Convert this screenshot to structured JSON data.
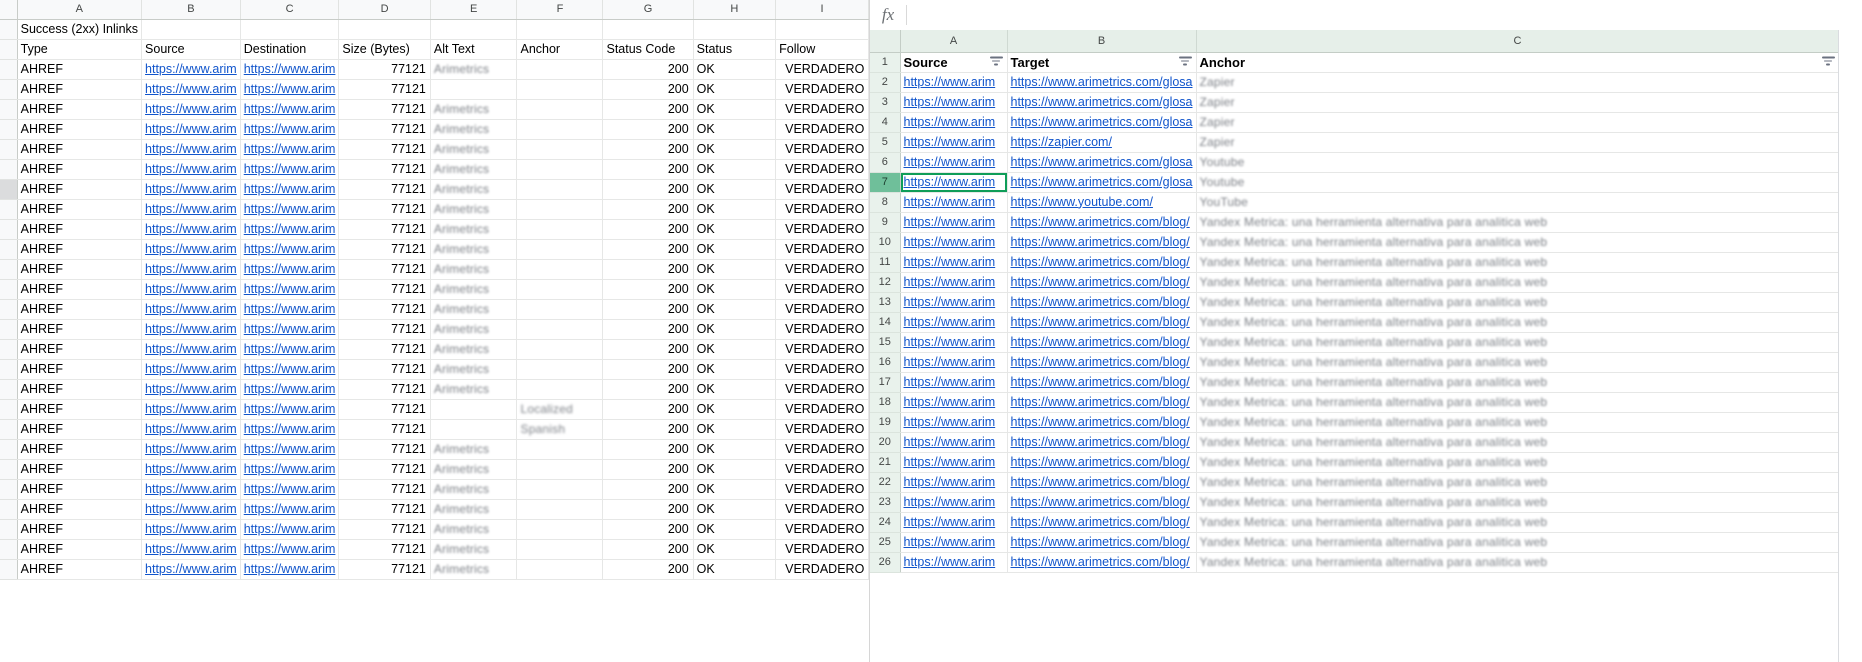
{
  "left_sheet": {
    "title_cell": "Success (2xx) Inlinks",
    "column_letters": [
      "A",
      "B",
      "C",
      "D",
      "E",
      "F",
      "G",
      "H",
      "I"
    ],
    "headers": [
      "Type",
      "Source",
      "Destination",
      "Size (Bytes)",
      "Alt Text",
      "Anchor",
      "Status Code",
      "Status",
      "Follow"
    ],
    "selected_row_index": 6,
    "rows": [
      {
        "type": "AHREF",
        "source": "https://www.arim",
        "destination": "https://www.arim",
        "size": "77121",
        "alt": "Arimetrics",
        "anchor": "",
        "status_code": "200",
        "status": "OK",
        "follow": "VERDADERO"
      },
      {
        "type": "AHREF",
        "source": "https://www.arim",
        "destination": "https://www.arim",
        "size": "77121",
        "alt": "",
        "anchor": "",
        "status_code": "200",
        "status": "OK",
        "follow": "VERDADERO"
      },
      {
        "type": "AHREF",
        "source": "https://www.arim",
        "destination": "https://www.arim",
        "size": "77121",
        "alt": "Arimetrics",
        "anchor": "",
        "status_code": "200",
        "status": "OK",
        "follow": "VERDADERO"
      },
      {
        "type": "AHREF",
        "source": "https://www.arim",
        "destination": "https://www.arim",
        "size": "77121",
        "alt": "Arimetrics",
        "anchor": "",
        "status_code": "200",
        "status": "OK",
        "follow": "VERDADERO"
      },
      {
        "type": "AHREF",
        "source": "https://www.arim",
        "destination": "https://www.arim",
        "size": "77121",
        "alt": "Arimetrics",
        "anchor": "",
        "status_code": "200",
        "status": "OK",
        "follow": "VERDADERO"
      },
      {
        "type": "AHREF",
        "source": "https://www.arim",
        "destination": "https://www.arim",
        "size": "77121",
        "alt": "Arimetrics",
        "anchor": "",
        "status_code": "200",
        "status": "OK",
        "follow": "VERDADERO"
      },
      {
        "type": "AHREF",
        "source": "https://www.arim",
        "destination": "https://www.arim",
        "size": "77121",
        "alt": "Arimetrics",
        "anchor": "",
        "status_code": "200",
        "status": "OK",
        "follow": "VERDADERO"
      },
      {
        "type": "AHREF",
        "source": "https://www.arim",
        "destination": "https://www.arim",
        "size": "77121",
        "alt": "Arimetrics",
        "anchor": "",
        "status_code": "200",
        "status": "OK",
        "follow": "VERDADERO"
      },
      {
        "type": "AHREF",
        "source": "https://www.arim",
        "destination": "https://www.arim",
        "size": "77121",
        "alt": "Arimetrics",
        "anchor": "",
        "status_code": "200",
        "status": "OK",
        "follow": "VERDADERO"
      },
      {
        "type": "AHREF",
        "source": "https://www.arim",
        "destination": "https://www.arim",
        "size": "77121",
        "alt": "Arimetrics",
        "anchor": "",
        "status_code": "200",
        "status": "OK",
        "follow": "VERDADERO"
      },
      {
        "type": "AHREF",
        "source": "https://www.arim",
        "destination": "https://www.arim",
        "size": "77121",
        "alt": "Arimetrics",
        "anchor": "",
        "status_code": "200",
        "status": "OK",
        "follow": "VERDADERO"
      },
      {
        "type": "AHREF",
        "source": "https://www.arim",
        "destination": "https://www.arim",
        "size": "77121",
        "alt": "Arimetrics",
        "anchor": "",
        "status_code": "200",
        "status": "OK",
        "follow": "VERDADERO"
      },
      {
        "type": "AHREF",
        "source": "https://www.arim",
        "destination": "https://www.arim",
        "size": "77121",
        "alt": "Arimetrics",
        "anchor": "",
        "status_code": "200",
        "status": "OK",
        "follow": "VERDADERO"
      },
      {
        "type": "AHREF",
        "source": "https://www.arim",
        "destination": "https://www.arim",
        "size": "77121",
        "alt": "Arimetrics",
        "anchor": "",
        "status_code": "200",
        "status": "OK",
        "follow": "VERDADERO"
      },
      {
        "type": "AHREF",
        "source": "https://www.arim",
        "destination": "https://www.arim",
        "size": "77121",
        "alt": "Arimetrics",
        "anchor": "",
        "status_code": "200",
        "status": "OK",
        "follow": "VERDADERO"
      },
      {
        "type": "AHREF",
        "source": "https://www.arim",
        "destination": "https://www.arim",
        "size": "77121",
        "alt": "Arimetrics",
        "anchor": "",
        "status_code": "200",
        "status": "OK",
        "follow": "VERDADERO"
      },
      {
        "type": "AHREF",
        "source": "https://www.arim",
        "destination": "https://www.arim",
        "size": "77121",
        "alt": "Arimetrics",
        "anchor": "",
        "status_code": "200",
        "status": "OK",
        "follow": "VERDADERO"
      },
      {
        "type": "AHREF",
        "source": "https://www.arim",
        "destination": "https://www.arim",
        "size": "77121",
        "alt": "",
        "anchor": "Localized",
        "status_code": "200",
        "status": "OK",
        "follow": "VERDADERO"
      },
      {
        "type": "AHREF",
        "source": "https://www.arim",
        "destination": "https://www.arim",
        "size": "77121",
        "alt": "",
        "anchor": "Spanish",
        "status_code": "200",
        "status": "OK",
        "follow": "VERDADERO"
      },
      {
        "type": "AHREF",
        "source": "https://www.arim",
        "destination": "https://www.arim",
        "size": "77121",
        "alt": "Arimetrics",
        "anchor": "",
        "status_code": "200",
        "status": "OK",
        "follow": "VERDADERO"
      },
      {
        "type": "AHREF",
        "source": "https://www.arim",
        "destination": "https://www.arim",
        "size": "77121",
        "alt": "Arimetrics",
        "anchor": "",
        "status_code": "200",
        "status": "OK",
        "follow": "VERDADERO"
      },
      {
        "type": "AHREF",
        "source": "https://www.arim",
        "destination": "https://www.arim",
        "size": "77121",
        "alt": "Arimetrics",
        "anchor": "",
        "status_code": "200",
        "status": "OK",
        "follow": "VERDADERO"
      },
      {
        "type": "AHREF",
        "source": "https://www.arim",
        "destination": "https://www.arim",
        "size": "77121",
        "alt": "Arimetrics",
        "anchor": "",
        "status_code": "200",
        "status": "OK",
        "follow": "VERDADERO"
      },
      {
        "type": "AHREF",
        "source": "https://www.arim",
        "destination": "https://www.arim",
        "size": "77121",
        "alt": "Arimetrics",
        "anchor": "",
        "status_code": "200",
        "status": "OK",
        "follow": "VERDADERO"
      },
      {
        "type": "AHREF",
        "source": "https://www.arim",
        "destination": "https://www.arim",
        "size": "77121",
        "alt": "Arimetrics",
        "anchor": "",
        "status_code": "200",
        "status": "OK",
        "follow": "VERDADERO"
      },
      {
        "type": "AHREF",
        "source": "https://www.arim",
        "destination": "https://www.arim",
        "size": "77121",
        "alt": "Arimetrics",
        "anchor": "",
        "status_code": "200",
        "status": "OK",
        "follow": "VERDADERO"
      }
    ]
  },
  "right_sheet": {
    "formula_bar": {
      "glyph": "fx",
      "value": "",
      "placeholder": ""
    },
    "column_letters": [
      "A",
      "B",
      "C"
    ],
    "headers": [
      "Source",
      "Target",
      "Anchor"
    ],
    "header_row_number": "1",
    "selected_row_number": "7",
    "filter_icon": "filter-icon",
    "accent_color": "#0f9d58",
    "header_bg": "#e6efe9",
    "link_color": "#1155cc",
    "rows": [
      {
        "n": "2",
        "source": "https://www.arim",
        "target": "https://www.arimetrics.com/glosa",
        "anchor": "Zapier"
      },
      {
        "n": "3",
        "source": "https://www.arim",
        "target": "https://www.arimetrics.com/glosa",
        "anchor": "Zapier"
      },
      {
        "n": "4",
        "source": "https://www.arim",
        "target": "https://www.arimetrics.com/glosa",
        "anchor": "Zapier"
      },
      {
        "n": "5",
        "source": "https://www.arim",
        "target": "https://zapier.com/",
        "anchor": "Zapier"
      },
      {
        "n": "6",
        "source": "https://www.arim",
        "target": "https://www.arimetrics.com/glosa",
        "anchor": "Youtube"
      },
      {
        "n": "7",
        "source": "https://www.arim",
        "target": "https://www.arimetrics.com/glosa",
        "anchor": "Youtube"
      },
      {
        "n": "8",
        "source": "https://www.arim",
        "target": "https://www.youtube.com/",
        "anchor": "YouTube"
      },
      {
        "n": "9",
        "source": "https://www.arim",
        "target": "https://www.arimetrics.com/blog/",
        "anchor": "Yandex Metrica: una herramienta alternativa para analitica web"
      },
      {
        "n": "10",
        "source": "https://www.arim",
        "target": "https://www.arimetrics.com/blog/",
        "anchor": "Yandex Metrica: una herramienta alternativa para analitica web"
      },
      {
        "n": "11",
        "source": "https://www.arim",
        "target": "https://www.arimetrics.com/blog/",
        "anchor": "Yandex Metrica: una herramienta alternativa para analitica web"
      },
      {
        "n": "12",
        "source": "https://www.arim",
        "target": "https://www.arimetrics.com/blog/",
        "anchor": "Yandex Metrica: una herramienta alternativa para analitica web"
      },
      {
        "n": "13",
        "source": "https://www.arim",
        "target": "https://www.arimetrics.com/blog/",
        "anchor": "Yandex Metrica: una herramienta alternativa para analitica web"
      },
      {
        "n": "14",
        "source": "https://www.arim",
        "target": "https://www.arimetrics.com/blog/",
        "anchor": "Yandex Metrica: una herramienta alternativa para analitica web"
      },
      {
        "n": "15",
        "source": "https://www.arim",
        "target": "https://www.arimetrics.com/blog/",
        "anchor": "Yandex Metrica: una herramienta alternativa para analitica web"
      },
      {
        "n": "16",
        "source": "https://www.arim",
        "target": "https://www.arimetrics.com/blog/",
        "anchor": "Yandex Metrica: una herramienta alternativa para analitica web"
      },
      {
        "n": "17",
        "source": "https://www.arim",
        "target": "https://www.arimetrics.com/blog/",
        "anchor": "Yandex Metrica: una herramienta alternativa para analitica web"
      },
      {
        "n": "18",
        "source": "https://www.arim",
        "target": "https://www.arimetrics.com/blog/",
        "anchor": "Yandex Metrica: una herramienta alternativa para analitica web"
      },
      {
        "n": "19",
        "source": "https://www.arim",
        "target": "https://www.arimetrics.com/blog/",
        "anchor": "Yandex Metrica: una herramienta alternativa para analitica web"
      },
      {
        "n": "20",
        "source": "https://www.arim",
        "target": "https://www.arimetrics.com/blog/",
        "anchor": "Yandex Metrica: una herramienta alternativa para analitica web"
      },
      {
        "n": "21",
        "source": "https://www.arim",
        "target": "https://www.arimetrics.com/blog/",
        "anchor": "Yandex Metrica: una herramienta alternativa para analitica web"
      },
      {
        "n": "22",
        "source": "https://www.arim",
        "target": "https://www.arimetrics.com/blog/",
        "anchor": "Yandex Metrica: una herramienta alternativa para analitica web"
      },
      {
        "n": "23",
        "source": "https://www.arim",
        "target": "https://www.arimetrics.com/blog/",
        "anchor": "Yandex Metrica: una herramienta alternativa para analitica web"
      },
      {
        "n": "24",
        "source": "https://www.arim",
        "target": "https://www.arimetrics.com/blog/",
        "anchor": "Yandex Metrica: una herramienta alternativa para analitica web"
      },
      {
        "n": "25",
        "source": "https://www.arim",
        "target": "https://www.arimetrics.com/blog/",
        "anchor": "Yandex Metrica: una herramienta alternativa para analitica web"
      },
      {
        "n": "26",
        "source": "https://www.arim",
        "target": "https://www.arimetrics.com/blog/",
        "anchor": "Yandex Metrica: una herramienta alternativa para analitica web"
      }
    ]
  }
}
